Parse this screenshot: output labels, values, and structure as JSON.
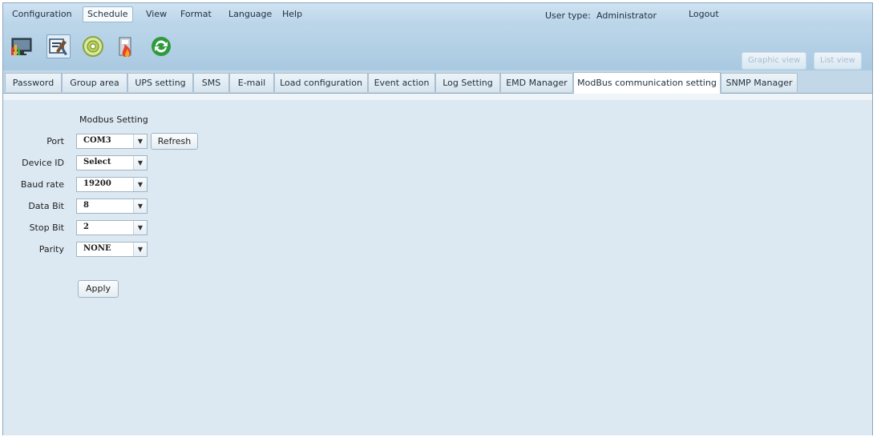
{
  "menu": {
    "items": [
      "Configuration",
      "Schedule",
      "View",
      "Format",
      "Language",
      "Help"
    ],
    "active": "Schedule"
  },
  "user": {
    "type_label": "User type:",
    "type_value": "Administrator",
    "logout": "Logout"
  },
  "toolbar": {
    "icons": [
      "monitor-chart-icon",
      "tools-settings-icon",
      "disc-icon",
      "battery-fire-icon",
      "refresh-cycle-icon"
    ],
    "selected_icon": "tools-settings-icon",
    "graphic_view": "Graphic view",
    "list_view": "List view"
  },
  "tabs": {
    "items": [
      "Password",
      "Group area",
      "UPS setting",
      "SMS",
      "E-mail",
      "Load configuration",
      "Event action",
      "Log Setting",
      "EMD Manager",
      "ModBus communication setting",
      "SNMP Manager"
    ],
    "active": "ModBus communication setting"
  },
  "modbus": {
    "title": "Modbus Setting",
    "fields": {
      "port": {
        "label": "Port",
        "value": "COM3"
      },
      "device_id": {
        "label": "Device ID",
        "value": "Select"
      },
      "baud_rate": {
        "label": "Baud rate",
        "value": "19200"
      },
      "data_bit": {
        "label": "Data Bit",
        "value": "8"
      },
      "stop_bit": {
        "label": "Stop Bit",
        "value": "2"
      },
      "parity": {
        "label": "Parity",
        "value": "NONE"
      }
    },
    "refresh_label": "Refresh",
    "apply_label": "Apply"
  },
  "colors": {
    "background": "#d6e7f1",
    "menubar": "#c4dced",
    "active_tab": "#ffffff"
  }
}
